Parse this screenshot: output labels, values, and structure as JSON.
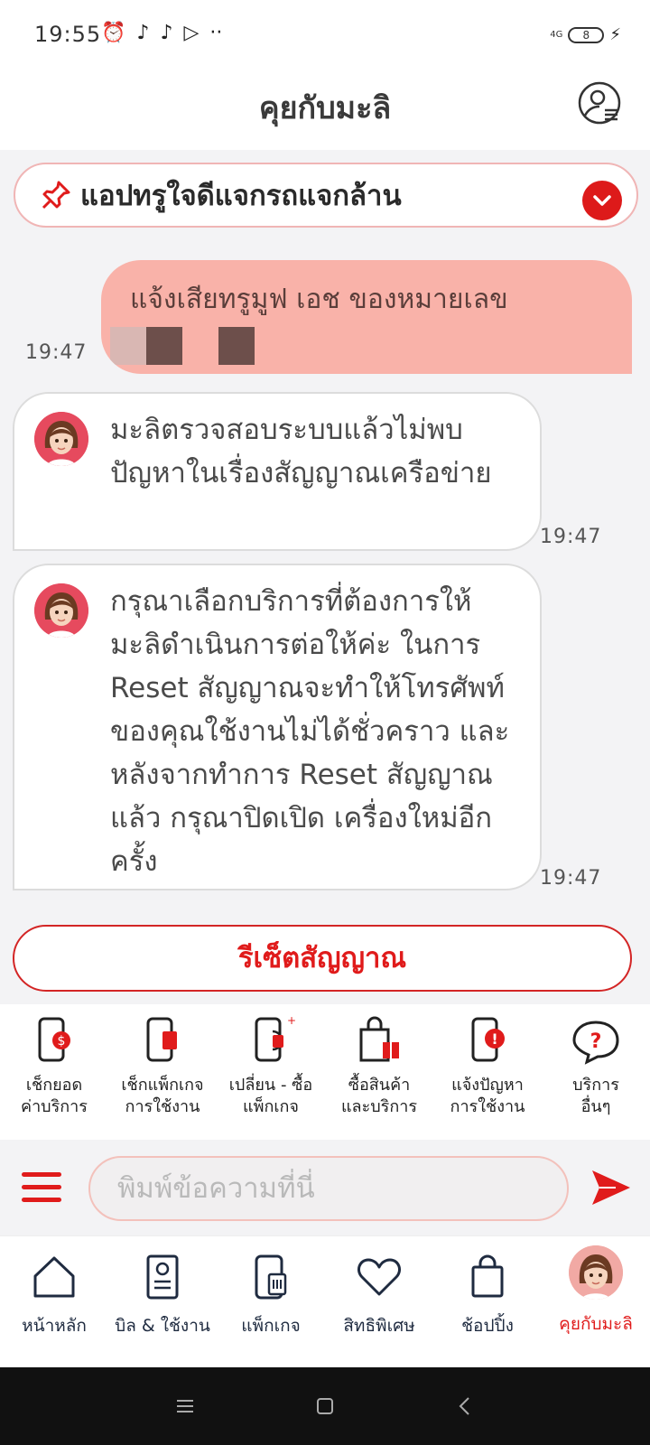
{
  "status_bar": {
    "time": "19:55",
    "notification_icons": [
      "alarm-icon",
      "tiktok-icon",
      "tiktok-icon",
      "play-icon",
      "more-dots-icon"
    ],
    "battery_level": "8"
  },
  "header": {
    "title": "คุยกับมะลิ",
    "profile_icon": "user-profile-icon"
  },
  "pinned": {
    "text": "แอปทรูใจดีแจกรถแจกล้าน",
    "icon": "pin-icon",
    "toggle_icon": "chevron-down-icon"
  },
  "messages": [
    {
      "from": "user",
      "text": "แจ้งเสียทรูมูฟ เอช ของหมายเลข",
      "time": "19:47"
    },
    {
      "from": "bot",
      "text": "มะลิตรวจสอบระบบแล้วไม่พบปัญหาในเรื่องสัญญาณเครือข่าย",
      "time": "19:47"
    },
    {
      "from": "bot",
      "text": "กรุณาเลือกบริการที่ต้องการให้มะลิดำเนินการต่อให้ค่ะ ในการ Reset สัญญาณจะทำให้โทรศัพท์ของคุณใช้งานไม่ได้ชั่วคราว และหลังจากทำการ Reset สัญญาณแล้ว กรุณาปิดเปิด เครื่องใหม่อีกครั้ง",
      "time": "19:47"
    }
  ],
  "reset_button": "รีเซ็ตสัญญาณ",
  "quick_services": [
    {
      "line1": "เช็กยอด",
      "line2": "ค่าบริการ"
    },
    {
      "line1": "เช็กแพ็กเกจ",
      "line2": "การใช้งาน"
    },
    {
      "line1": "เปลี่ยน - ซื้อ",
      "line2": "แพ็กเกจ"
    },
    {
      "line1": "ซื้อสินค้า",
      "line2": "และบริการ"
    },
    {
      "line1": "แจ้งปัญหา",
      "line2": "การใช้งาน"
    },
    {
      "line1": "บริการ",
      "line2": "อื่นๆ"
    }
  ],
  "input": {
    "placeholder": "พิมพ์ข้อความที่นี่"
  },
  "bottom_nav": [
    {
      "label": "หน้าหลัก",
      "icon": "home-icon"
    },
    {
      "label": "บิล & ใช้งาน",
      "icon": "bill-icon"
    },
    {
      "label": "แพ็กเกจ",
      "icon": "package-icon"
    },
    {
      "label": "สิทธิพิเศษ",
      "icon": "heart-icon"
    },
    {
      "label": "ช้อปปิ้ง",
      "icon": "shopping-bag-icon"
    },
    {
      "label": "คุยกับมะลิ",
      "icon": "mali-avatar-icon",
      "active": true
    }
  ],
  "colors": {
    "brand_red": "#e01b1b",
    "user_bubble": "#f9b2a9",
    "chat_bg": "#f3f3f5"
  }
}
